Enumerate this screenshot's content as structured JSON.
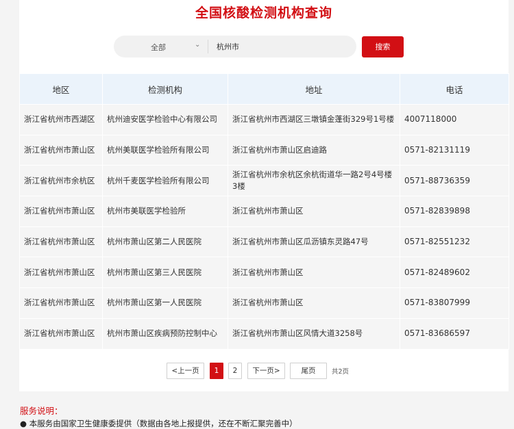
{
  "page": {
    "title": "全国核酸检测机构查询"
  },
  "search": {
    "region_value": "全部",
    "query": "杭州市",
    "button_label": "搜索"
  },
  "table": {
    "headers": [
      "地区",
      "检测机构",
      "地址",
      "电话"
    ],
    "rows": [
      [
        "浙江省杭州市西湖区",
        "杭州迪安医学检验中心有限公司",
        "浙江省杭州市西湖区三墩镇金蓬街329号1号楼",
        "4007118000"
      ],
      [
        "浙江省杭州市萧山区",
        "杭州美联医学检验所有限公司",
        "浙江省杭州市萧山区启迪路",
        "0571-82131119"
      ],
      [
        "浙江省杭州市余杭区",
        "杭州千麦医学检验所有限公司",
        "浙江省杭州市余杭区余杭街道华一路2号4号楼3楼",
        "0571-88736359"
      ],
      [
        "浙江省杭州市萧山区",
        "杭州市美联医学检验所",
        "浙江省杭州市萧山区",
        "0571-82839898"
      ],
      [
        "浙江省杭州市萧山区",
        "杭州市萧山区第二人民医院",
        "浙江省杭州市萧山区瓜沥镇东灵路47号",
        "0571-82551232"
      ],
      [
        "浙江省杭州市萧山区",
        "杭州市萧山区第三人民医院",
        "浙江省杭州市萧山区",
        "0571-82489602"
      ],
      [
        "浙江省杭州市萧山区",
        "杭州市萧山区第一人民医院",
        "浙江省杭州市萧山区",
        "0571-83807999"
      ],
      [
        "浙江省杭州市萧山区",
        "杭州市萧山区疾病预防控制中心",
        "浙江省杭州市萧山区风情大道3258号",
        "0571-83686597"
      ]
    ]
  },
  "pagination": {
    "prev_label": "<上一页",
    "pages": [
      "1",
      "2"
    ],
    "current_page": "1",
    "next_label": "下一页>",
    "last_label": "尾页",
    "total_label": "共2页"
  },
  "notice": {
    "title": "服务说明：",
    "items": [
      "● 本服务由国家卫生健康委提供（数据由各地上报提供，还在不断汇聚完善中）"
    ]
  },
  "colors": {
    "accent": "#d20f14",
    "header_bg": "#ebf3fb",
    "row_bg": "#f5f5f5"
  }
}
